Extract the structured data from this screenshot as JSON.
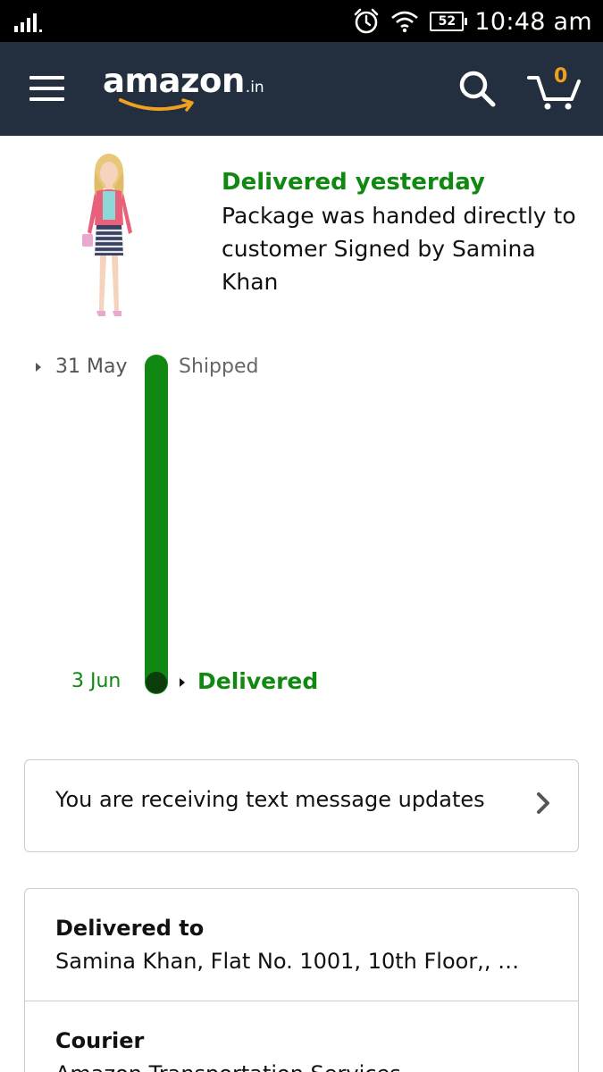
{
  "status_bar": {
    "time": "10:48 am",
    "battery": "52",
    "icons": [
      "signal-icon",
      "alarm-icon",
      "wifi-icon",
      "battery-icon"
    ]
  },
  "header": {
    "logo_word": "amazon",
    "logo_tld": ".in",
    "cart_count": "0",
    "icons": [
      "menu-icon",
      "search-icon",
      "cart-icon"
    ],
    "colors": {
      "bar": "#232f3e",
      "smile": "#f0a020"
    }
  },
  "delivery": {
    "status_title": "Delivered yesterday",
    "status_detail": "Package was handed directly to customer Signed by Samina Khan"
  },
  "timeline": {
    "start_date": "31 May",
    "start_label": "Shipped",
    "end_date": "3 Jun",
    "end_label": "Delivered",
    "progress": 1.0,
    "color": "#118811"
  },
  "sms_updates": {
    "text": "You are receiving text message updates"
  },
  "details": {
    "delivered_to_label": "Delivered to",
    "delivered_to_value": "Samina Khan, Flat No. 1001, 10th Floor,, …",
    "courier_label": "Courier",
    "courier_value": "Amazon Transportation Services"
  }
}
